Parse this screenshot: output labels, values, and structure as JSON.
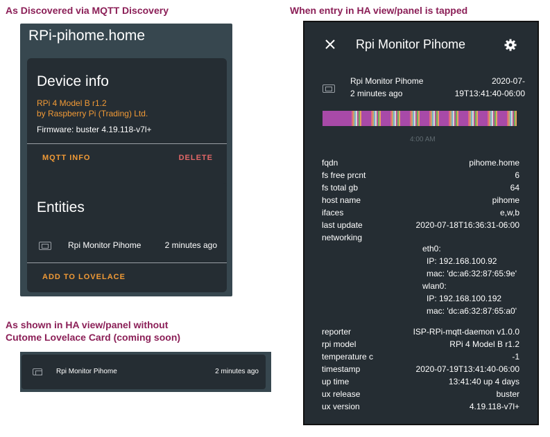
{
  "captions": {
    "discovered": "As Discovered via MQTT Discovery",
    "tapped": "When entry in HA view/panel is tapped",
    "shown_line1": "As shown in HA view/panel without",
    "shown_line2": "Cutome Lovelace Card (coming soon)"
  },
  "device": {
    "title": "RPi-pihome.home",
    "info_heading": "Device info",
    "model": "RPi 4 Model B r1.2",
    "manufacturer": "by Raspberry Pi (Trading) Ltd.",
    "firmware": "Firmware: buster 4.19.118-v7l+",
    "mqtt_info_label": "MQTT INFO",
    "delete_label": "DELETE",
    "entities_heading": "Entities",
    "entity_name": "Rpi Monitor Pihome",
    "entity_state": "2 minutes ago",
    "add_lovelace_label": "ADD TO LOVELACE"
  },
  "mini": {
    "entity_name": "Rpi Monitor Pihome",
    "entity_state": "2 minutes ago"
  },
  "popup": {
    "title": "Rpi Monitor Pihome",
    "entity_name": "Rpi Monitor Pihome",
    "entity_state": "2 minutes ago",
    "timestamp_line1": "2020-07-",
    "timestamp_line2": "19T13:41:40-06:00",
    "history_time": "4:00 AM",
    "attributes": [
      {
        "key": "fqdn",
        "value": "pihome.home"
      },
      {
        "key": "fs free prcnt",
        "value": "6"
      },
      {
        "key": "fs total gb",
        "value": "64"
      },
      {
        "key": "host name",
        "value": "pihome"
      },
      {
        "key": "ifaces",
        "value": "e,w,b"
      },
      {
        "key": "last update",
        "value": "2020-07-18T16:36:31-06:00"
      },
      {
        "key": "networking",
        "value": ""
      }
    ],
    "networking": {
      "eth0": "eth0:",
      "eth0_ip": "IP: 192.168.100.92",
      "eth0_mac": "mac: 'dc:a6:32:87:65:9e'",
      "wlan0": "wlan0:",
      "wlan0_ip": "IP: 192.168.100.192",
      "wlan0_mac": "mac: 'dc:a6:32:87:65:a0'"
    },
    "attributes2": [
      {
        "key": "reporter",
        "value": "ISP-RPi-mqtt-daemon v1.0.0"
      },
      {
        "key": "rpi model",
        "value": "RPi 4 Model B r1.2"
      },
      {
        "key": "temperature c",
        "value": "-1"
      },
      {
        "key": "timestamp",
        "value": "2020-07-19T13:41:40-06:00"
      },
      {
        "key": "up time",
        "value": "13:41:40 up 4 days"
      },
      {
        "key": "ux release",
        "value": "buster"
      },
      {
        "key": "ux version",
        "value": "4.19.118-v7l+"
      }
    ]
  },
  "colors": {
    "caption": "#8b1f57",
    "accent": "#f19a36",
    "danger": "#e26767",
    "card": "#252d33",
    "panel": "#37474f"
  }
}
